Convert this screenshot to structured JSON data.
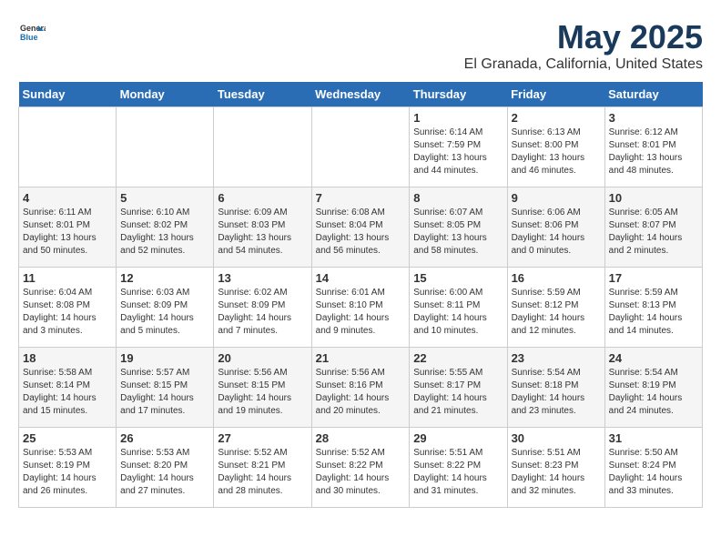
{
  "header": {
    "logo_general": "General",
    "logo_blue": "Blue",
    "title": "May 2025",
    "subtitle": "El Granada, California, United States"
  },
  "days_of_week": [
    "Sunday",
    "Monday",
    "Tuesday",
    "Wednesday",
    "Thursday",
    "Friday",
    "Saturday"
  ],
  "weeks": [
    [
      {
        "day": "",
        "detail": ""
      },
      {
        "day": "",
        "detail": ""
      },
      {
        "day": "",
        "detail": ""
      },
      {
        "day": "",
        "detail": ""
      },
      {
        "day": "1",
        "detail": "Sunrise: 6:14 AM\nSunset: 7:59 PM\nDaylight: 13 hours\nand 44 minutes."
      },
      {
        "day": "2",
        "detail": "Sunrise: 6:13 AM\nSunset: 8:00 PM\nDaylight: 13 hours\nand 46 minutes."
      },
      {
        "day": "3",
        "detail": "Sunrise: 6:12 AM\nSunset: 8:01 PM\nDaylight: 13 hours\nand 48 minutes."
      }
    ],
    [
      {
        "day": "4",
        "detail": "Sunrise: 6:11 AM\nSunset: 8:01 PM\nDaylight: 13 hours\nand 50 minutes."
      },
      {
        "day": "5",
        "detail": "Sunrise: 6:10 AM\nSunset: 8:02 PM\nDaylight: 13 hours\nand 52 minutes."
      },
      {
        "day": "6",
        "detail": "Sunrise: 6:09 AM\nSunset: 8:03 PM\nDaylight: 13 hours\nand 54 minutes."
      },
      {
        "day": "7",
        "detail": "Sunrise: 6:08 AM\nSunset: 8:04 PM\nDaylight: 13 hours\nand 56 minutes."
      },
      {
        "day": "8",
        "detail": "Sunrise: 6:07 AM\nSunset: 8:05 PM\nDaylight: 13 hours\nand 58 minutes."
      },
      {
        "day": "9",
        "detail": "Sunrise: 6:06 AM\nSunset: 8:06 PM\nDaylight: 14 hours\nand 0 minutes."
      },
      {
        "day": "10",
        "detail": "Sunrise: 6:05 AM\nSunset: 8:07 PM\nDaylight: 14 hours\nand 2 minutes."
      }
    ],
    [
      {
        "day": "11",
        "detail": "Sunrise: 6:04 AM\nSunset: 8:08 PM\nDaylight: 14 hours\nand 3 minutes."
      },
      {
        "day": "12",
        "detail": "Sunrise: 6:03 AM\nSunset: 8:09 PM\nDaylight: 14 hours\nand 5 minutes."
      },
      {
        "day": "13",
        "detail": "Sunrise: 6:02 AM\nSunset: 8:09 PM\nDaylight: 14 hours\nand 7 minutes."
      },
      {
        "day": "14",
        "detail": "Sunrise: 6:01 AM\nSunset: 8:10 PM\nDaylight: 14 hours\nand 9 minutes."
      },
      {
        "day": "15",
        "detail": "Sunrise: 6:00 AM\nSunset: 8:11 PM\nDaylight: 14 hours\nand 10 minutes."
      },
      {
        "day": "16",
        "detail": "Sunrise: 5:59 AM\nSunset: 8:12 PM\nDaylight: 14 hours\nand 12 minutes."
      },
      {
        "day": "17",
        "detail": "Sunrise: 5:59 AM\nSunset: 8:13 PM\nDaylight: 14 hours\nand 14 minutes."
      }
    ],
    [
      {
        "day": "18",
        "detail": "Sunrise: 5:58 AM\nSunset: 8:14 PM\nDaylight: 14 hours\nand 15 minutes."
      },
      {
        "day": "19",
        "detail": "Sunrise: 5:57 AM\nSunset: 8:15 PM\nDaylight: 14 hours\nand 17 minutes."
      },
      {
        "day": "20",
        "detail": "Sunrise: 5:56 AM\nSunset: 8:15 PM\nDaylight: 14 hours\nand 19 minutes."
      },
      {
        "day": "21",
        "detail": "Sunrise: 5:56 AM\nSunset: 8:16 PM\nDaylight: 14 hours\nand 20 minutes."
      },
      {
        "day": "22",
        "detail": "Sunrise: 5:55 AM\nSunset: 8:17 PM\nDaylight: 14 hours\nand 21 minutes."
      },
      {
        "day": "23",
        "detail": "Sunrise: 5:54 AM\nSunset: 8:18 PM\nDaylight: 14 hours\nand 23 minutes."
      },
      {
        "day": "24",
        "detail": "Sunrise: 5:54 AM\nSunset: 8:19 PM\nDaylight: 14 hours\nand 24 minutes."
      }
    ],
    [
      {
        "day": "25",
        "detail": "Sunrise: 5:53 AM\nSunset: 8:19 PM\nDaylight: 14 hours\nand 26 minutes."
      },
      {
        "day": "26",
        "detail": "Sunrise: 5:53 AM\nSunset: 8:20 PM\nDaylight: 14 hours\nand 27 minutes."
      },
      {
        "day": "27",
        "detail": "Sunrise: 5:52 AM\nSunset: 8:21 PM\nDaylight: 14 hours\nand 28 minutes."
      },
      {
        "day": "28",
        "detail": "Sunrise: 5:52 AM\nSunset: 8:22 PM\nDaylight: 14 hours\nand 30 minutes."
      },
      {
        "day": "29",
        "detail": "Sunrise: 5:51 AM\nSunset: 8:22 PM\nDaylight: 14 hours\nand 31 minutes."
      },
      {
        "day": "30",
        "detail": "Sunrise: 5:51 AM\nSunset: 8:23 PM\nDaylight: 14 hours\nand 32 minutes."
      },
      {
        "day": "31",
        "detail": "Sunrise: 5:50 AM\nSunset: 8:24 PM\nDaylight: 14 hours\nand 33 minutes."
      }
    ]
  ]
}
